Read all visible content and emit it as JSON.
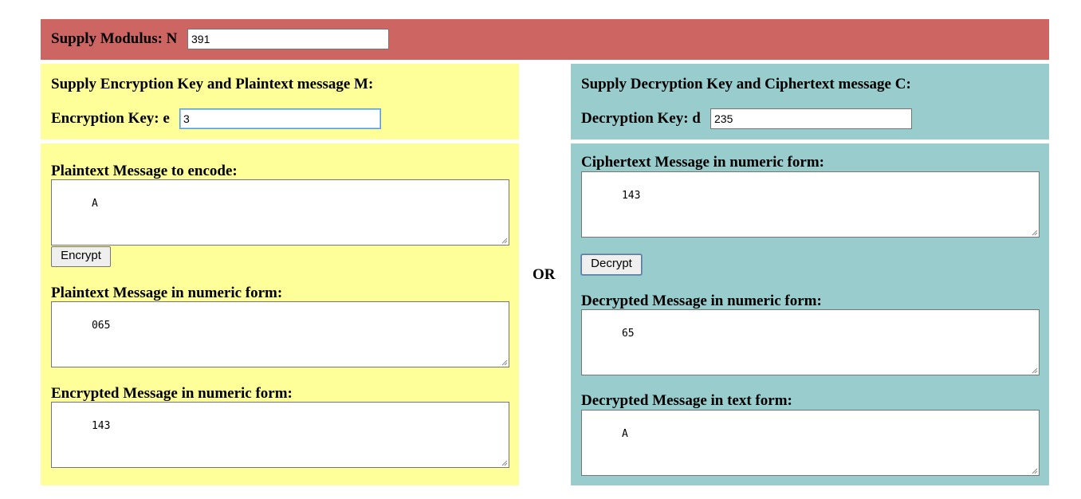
{
  "modulus": {
    "label": "Supply Modulus: N",
    "value": "391"
  },
  "encryption": {
    "header": "Supply Encryption Key and Plaintext message M:",
    "key_label": "Encryption Key: e",
    "key_value": "3",
    "plaintext_label": "Plaintext Message to encode:",
    "plaintext_value": "A",
    "encrypt_button": "Encrypt",
    "numeric_label": "Plaintext Message in numeric form:",
    "numeric_value": "065",
    "encrypted_label": "Encrypted Message in numeric form:",
    "encrypted_value": "143"
  },
  "separator": "OR",
  "decryption": {
    "header": "Supply Decryption Key and Ciphertext message C:",
    "key_label": "Decryption Key: d",
    "key_value": "235",
    "ciphertext_label": "Ciphertext Message in numeric form:",
    "ciphertext_value": "143",
    "decrypt_button": "Decrypt",
    "decrypted_numeric_label": "Decrypted Message in numeric form:",
    "decrypted_numeric_value": "65",
    "decrypted_text_label": "Decrypted Message in text form:",
    "decrypted_text_value": "A"
  },
  "colors": {
    "modulus_bar": "#cd6563",
    "encryption_panel": "#ffff99",
    "decryption_panel": "#99cccc"
  }
}
